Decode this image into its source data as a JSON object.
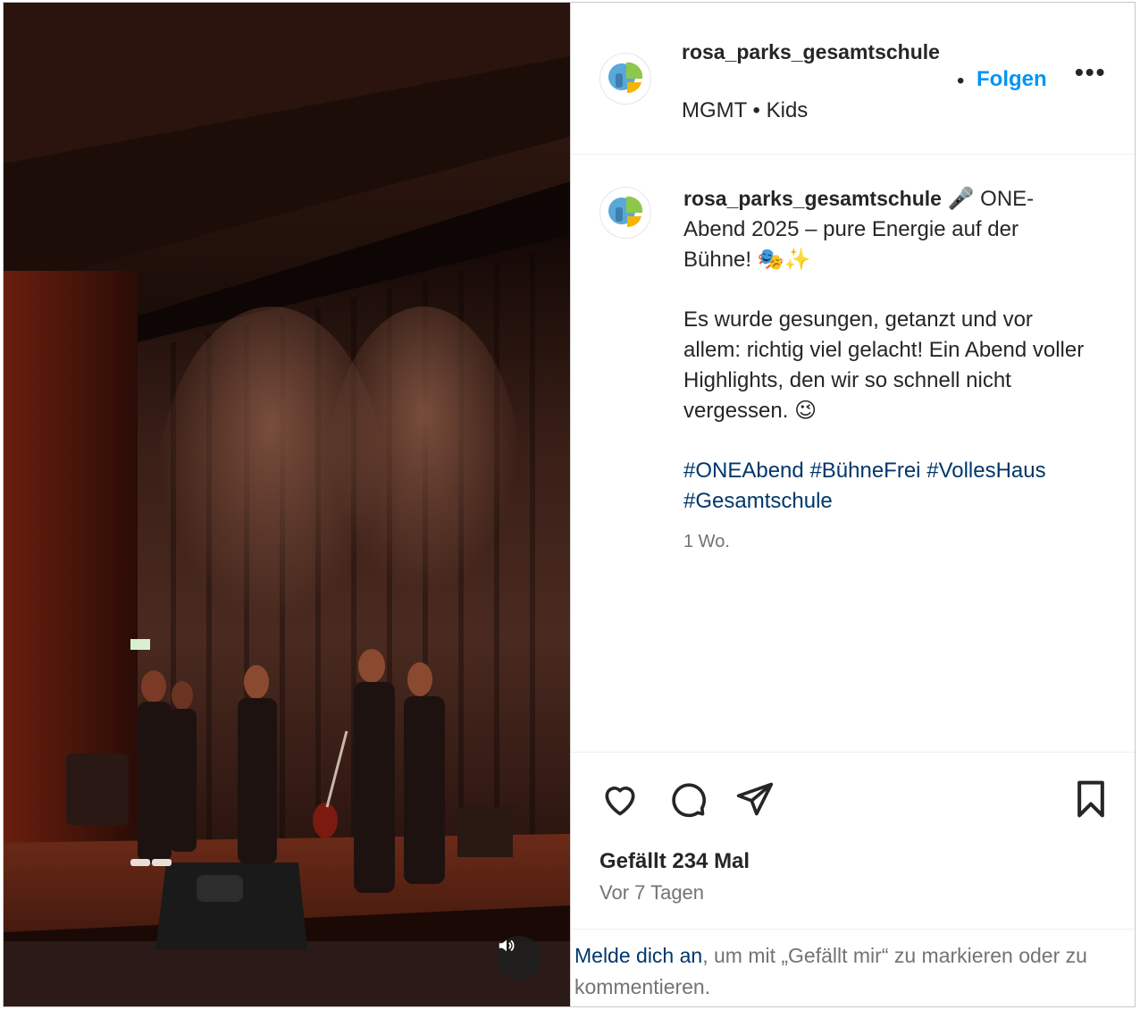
{
  "post": {
    "account": {
      "username_header": "rosa_parks_gesamtschule",
      "subline": "MGMT • Kids",
      "follow_separator": "•",
      "follow_label": "Folgen",
      "more_label": "•••"
    },
    "caption": {
      "username": "rosa_parks_gesamtschule",
      "line1": "🎤 ONE-Abend 2025 – pure Energie auf der Bühne! 🎭✨",
      "line2": "Es wurde gesungen, getanzt und vor allem: richtig viel gelacht! Ein Abend voller Highlights, den wir so schnell nicht vergessen. 😉",
      "hashtags": [
        "#ONEAbend",
        "#BühneFrei",
        "#VollesHaus",
        "#Gesamtschule"
      ],
      "time_ago": "1 Wo."
    },
    "actions": {
      "icons": [
        "heart-icon",
        "comment-icon",
        "share-icon",
        "bookmark-icon"
      ],
      "likes": "Gefällt 234 Mal",
      "date": "Vor 7 Tagen"
    },
    "login": {
      "link": "Melde dich an",
      "rest": ", um mit „Gefällt mir“ zu markieren oder zu kommentieren."
    },
    "media": {
      "audio_icon": "speaker-icon"
    }
  },
  "colors": {
    "accent": "#0095f6",
    "link": "#00376b",
    "muted": "#737373",
    "text": "#262626"
  }
}
